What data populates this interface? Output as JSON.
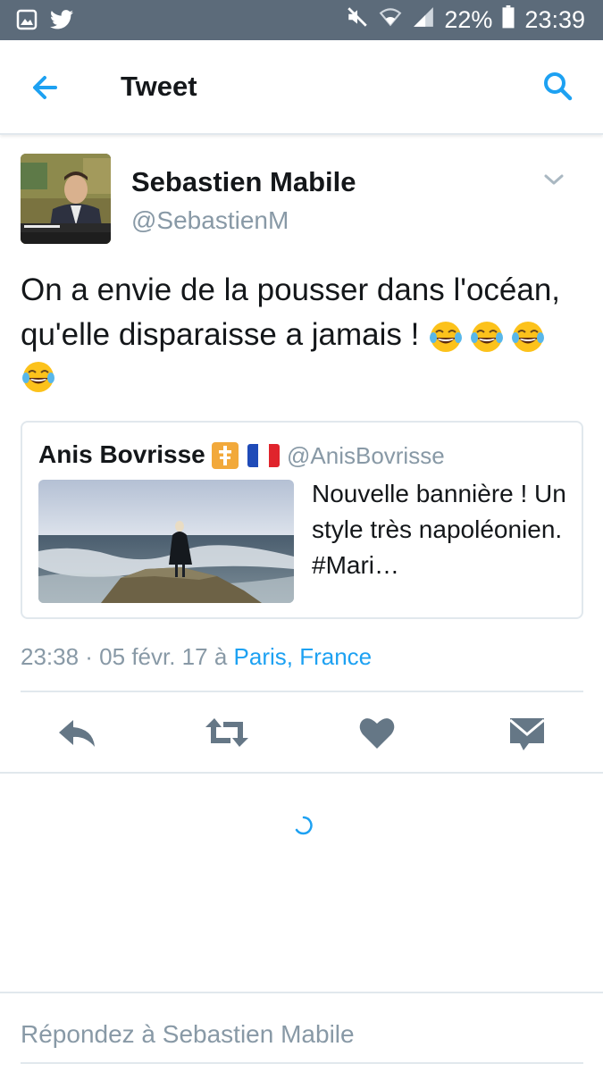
{
  "status_bar": {
    "battery": "22%",
    "time": "23:39",
    "icons": [
      "gallery-icon",
      "twitter-bird-icon",
      "mute-icon",
      "wifi-icon",
      "signal-icon",
      "battery-icon"
    ]
  },
  "app_bar": {
    "title": "Tweet",
    "back_icon": "arrow-left-icon",
    "search_icon": "search-icon"
  },
  "tweet": {
    "author_name": "Sebastien Mabile",
    "author_handle": "@SebastienM",
    "text": "On a envie de la pousser dans l'océan, qu'elle disparaisse a jamais !",
    "emojis": [
      "😂",
      "😂",
      "😂",
      "😂"
    ],
    "timestamp": "23:38 · 05 févr. 17",
    "location_prefix": "à",
    "location": "Paris, France"
  },
  "quoted_tweet": {
    "author_name": "Anis Bovrisse",
    "author_handle": "@AnisBovrisse",
    "name_icons": [
      "cross-emoji-icon",
      "french-flag-icon"
    ],
    "text": "Nouvelle bannière ! Un style très napoléonien. #Mari…"
  },
  "actions": [
    "reply-icon",
    "retweet-icon",
    "like-icon",
    "direct-message-icon"
  ],
  "reply": {
    "placeholder": "Répondez à Sebastien Mabile"
  },
  "colors": {
    "status_bar": "#5c6b7a",
    "accent": "#1da1f2",
    "muted": "#8899a6",
    "icon": "#657786"
  }
}
